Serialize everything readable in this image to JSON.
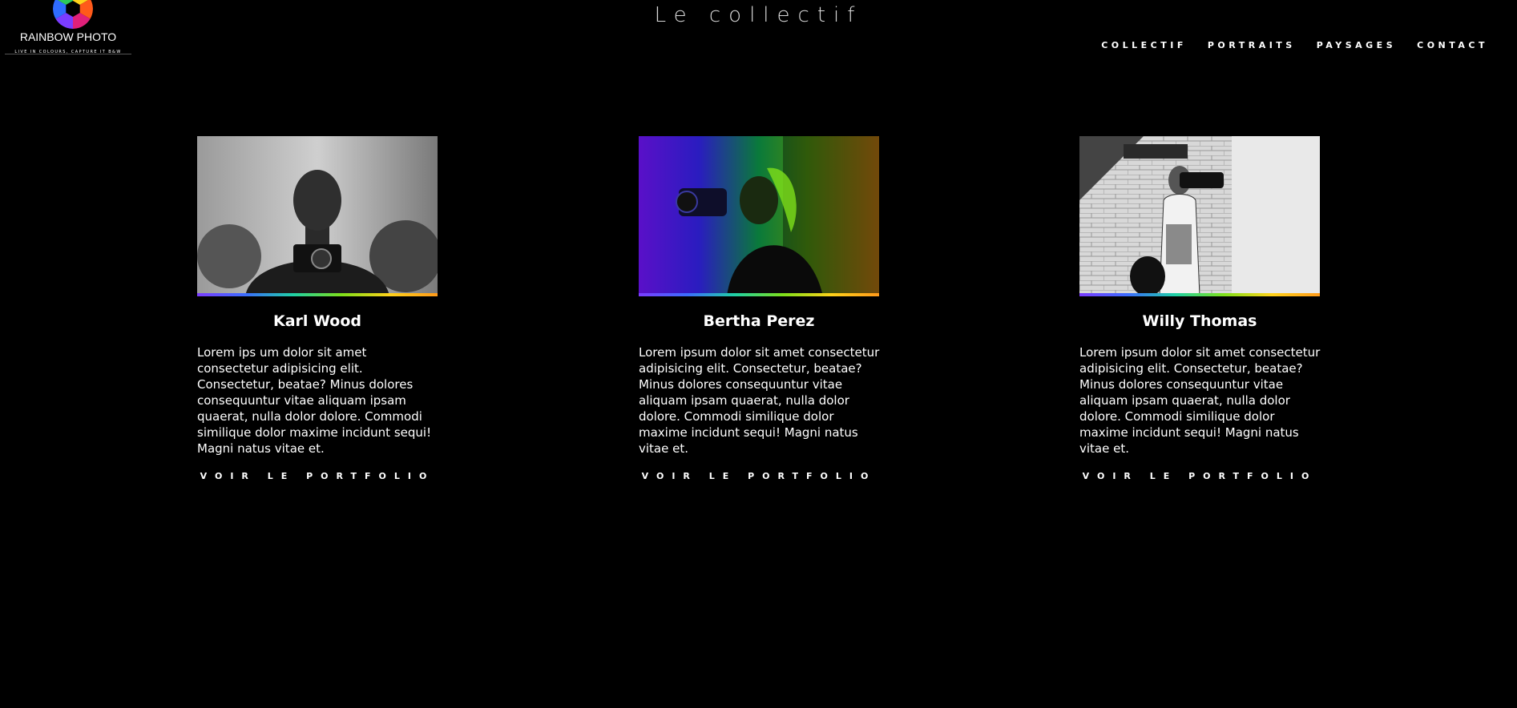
{
  "header": {
    "logo": {
      "title": "RAINBOW PHOTO",
      "tagline": "LIVE IN COLOURS, CAPTURE IT B&W"
    },
    "page_title": "Le collectif",
    "nav": [
      {
        "label": "COLLECTIF"
      },
      {
        "label": "PORTRAITS"
      },
      {
        "label": "PAYSAGES"
      },
      {
        "label": "CONTACT"
      }
    ]
  },
  "members": [
    {
      "name": "Karl Wood",
      "bio": "Lorem ips um dolor sit amet consectetur adipisicing elit. Consectetur, beatae? Minus dolores consequuntur vitae aliquam ipsam quaerat, nulla dolor dolore. Commodi similique dolor maxime incidunt sequi! Magni natus vitae et.",
      "button": "VOIR LE PORTFOLIO"
    },
    {
      "name": "Bertha Perez",
      "bio": "Lorem ipsum dolor sit amet consectetur adipisicing elit. Consectetur, beatae? Minus dolores consequuntur vitae aliquam ipsam quaerat, nulla dolor dolore. Commodi similique dolor maxime incidunt sequi! Magni natus vitae et.",
      "button": "VOIR LE PORTFOLIO"
    },
    {
      "name": "Willy Thomas",
      "bio": "Lorem ipsum dolor sit amet consectetur adipisicing elit. Consectetur, beatae? Minus dolores consequuntur vitae aliquam ipsam quaerat, nulla dolor dolore. Commodi similique dolor maxime incidunt sequi! Magni natus vitae et.",
      "button": "VOIR LE PORTFOLIO"
    }
  ],
  "colors": {
    "background": "#000000",
    "text": "#ffffff"
  },
  "icons": {
    "logo": "rainbow-aperture-icon"
  }
}
